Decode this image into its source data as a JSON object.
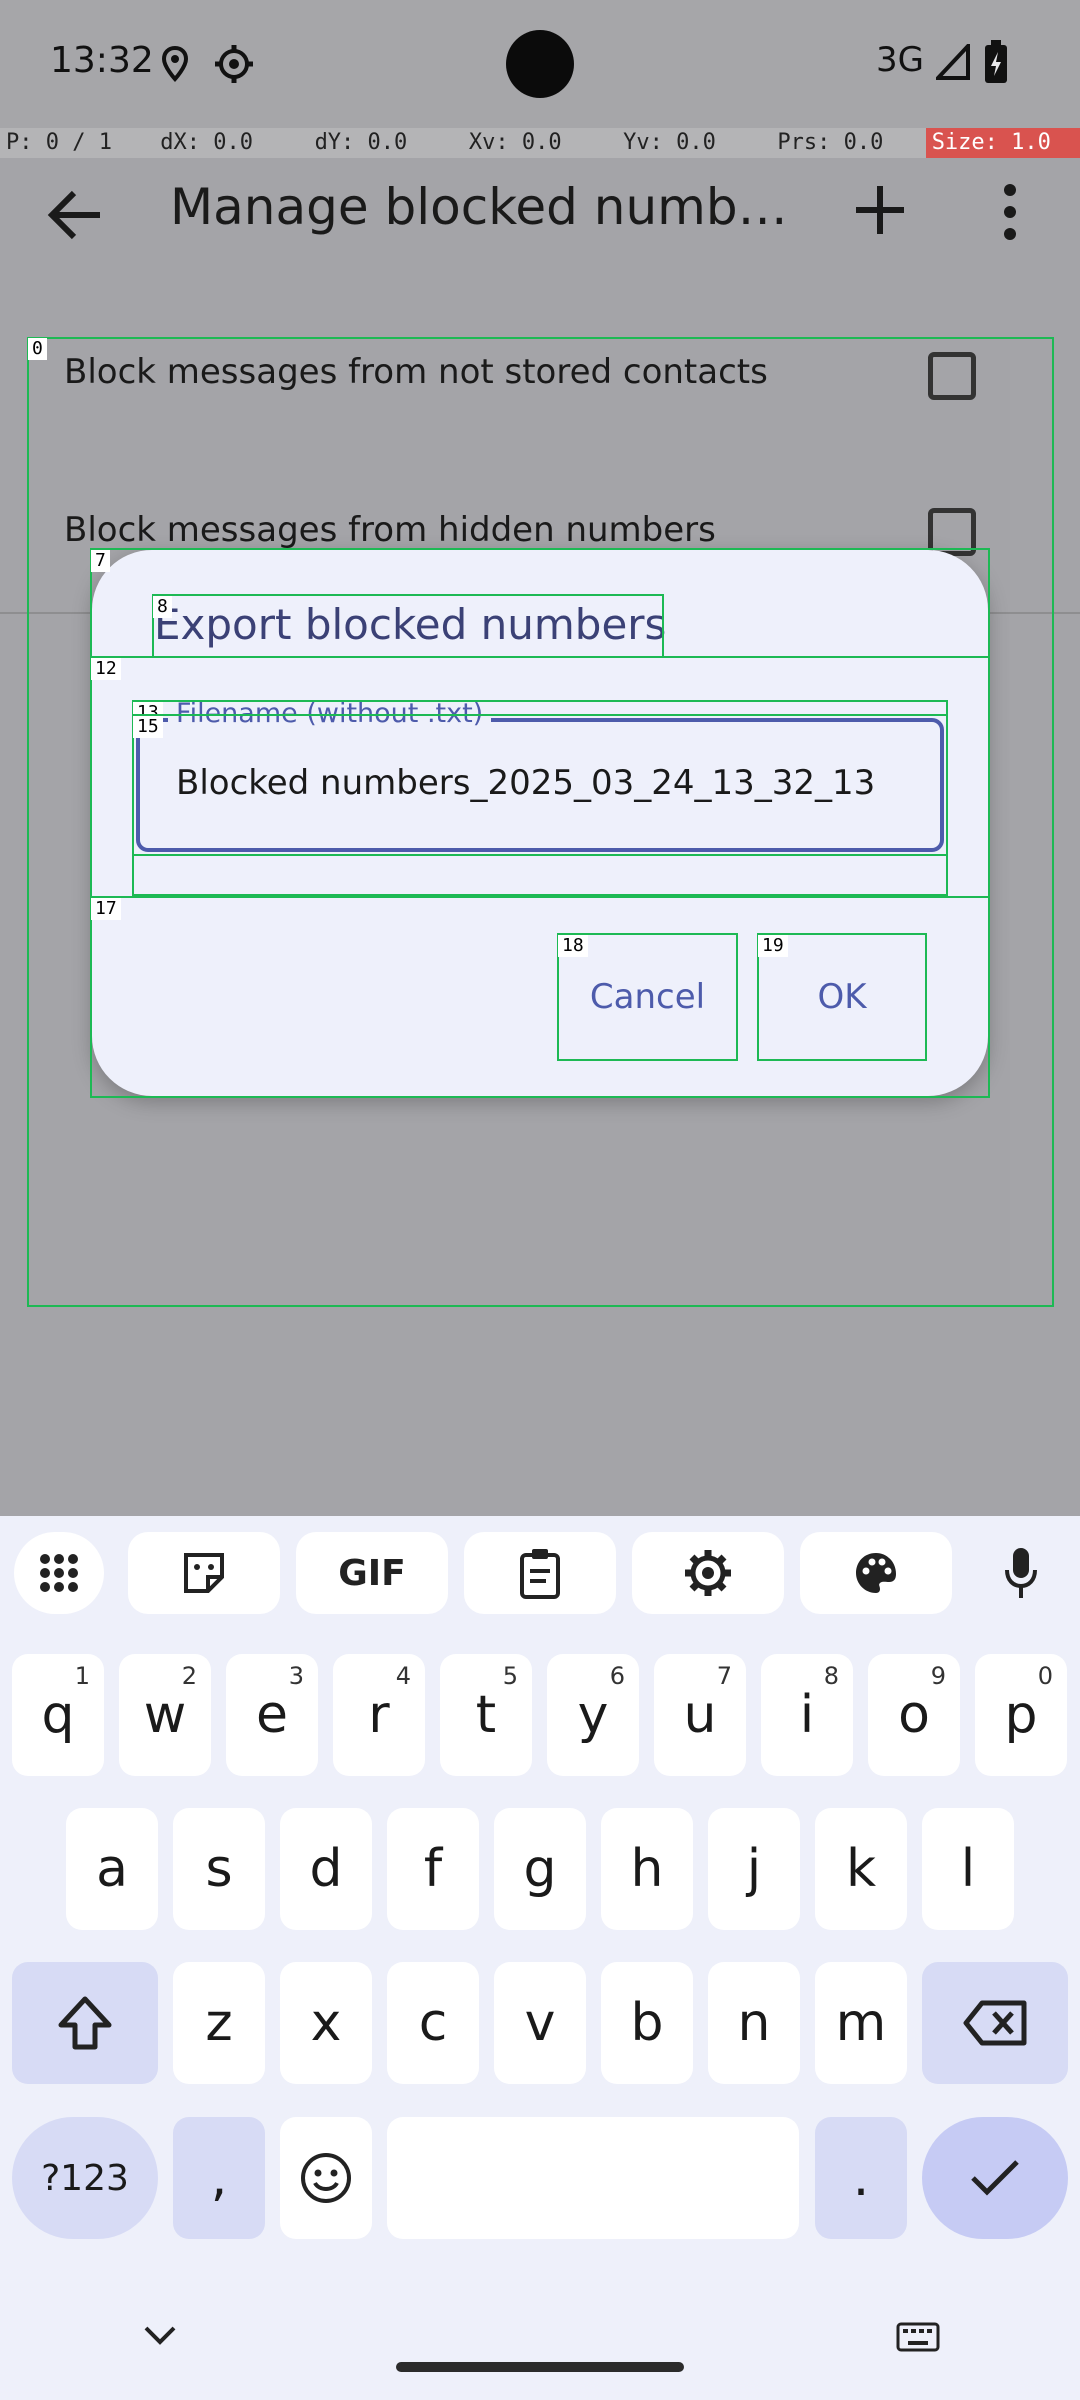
{
  "status_bar": {
    "time": "13:32",
    "network": "3G",
    "icons": [
      "location-icon",
      "settings-icon",
      "signal-icon",
      "battery-icon"
    ]
  },
  "debug_overlay": {
    "cells": [
      "P: 0 / 1",
      "dX: 0.0",
      "dY: 0.0",
      "Xv: 0.0",
      "Yv: 0.0",
      "Prs: 0.0",
      "Size: 1.0"
    ]
  },
  "app_bar": {
    "title": "Manage blocked numbers",
    "back_icon": "arrow-back-icon",
    "add_icon": "plus-icon",
    "more_icon": "more-vert-icon"
  },
  "list": {
    "items": [
      {
        "label": "Block messages from not stored contacts",
        "checked": false
      },
      {
        "label": "Block messages from hidden numbers",
        "checked": false
      }
    ]
  },
  "debug_tags": [
    "0",
    "7",
    "8",
    "12",
    "13",
    "15",
    "17",
    "18",
    "19"
  ],
  "dialog": {
    "title": "Export blocked numbers",
    "field_label": "Filename (without .txt)",
    "field_value": "Blocked numbers_2025_03_24_13_32_13",
    "cancel_label": "Cancel",
    "ok_label": "OK"
  },
  "keyboard": {
    "toolbar": [
      "apps-grid-icon",
      "sticker-icon",
      "GIF",
      "clipboard-icon",
      "settings-icon",
      "palette-icon",
      "mic-icon"
    ],
    "row1": [
      {
        "k": "q",
        "h": "1"
      },
      {
        "k": "w",
        "h": "2"
      },
      {
        "k": "e",
        "h": "3"
      },
      {
        "k": "r",
        "h": "4"
      },
      {
        "k": "t",
        "h": "5"
      },
      {
        "k": "y",
        "h": "6"
      },
      {
        "k": "u",
        "h": "7"
      },
      {
        "k": "i",
        "h": "8"
      },
      {
        "k": "o",
        "h": "9"
      },
      {
        "k": "p",
        "h": "0"
      }
    ],
    "row2": [
      "a",
      "s",
      "d",
      "f",
      "g",
      "h",
      "j",
      "k",
      "l"
    ],
    "row3": [
      "z",
      "x",
      "c",
      "v",
      "b",
      "n",
      "m"
    ],
    "symbols_label": "?123",
    "comma": ",",
    "period": "."
  }
}
